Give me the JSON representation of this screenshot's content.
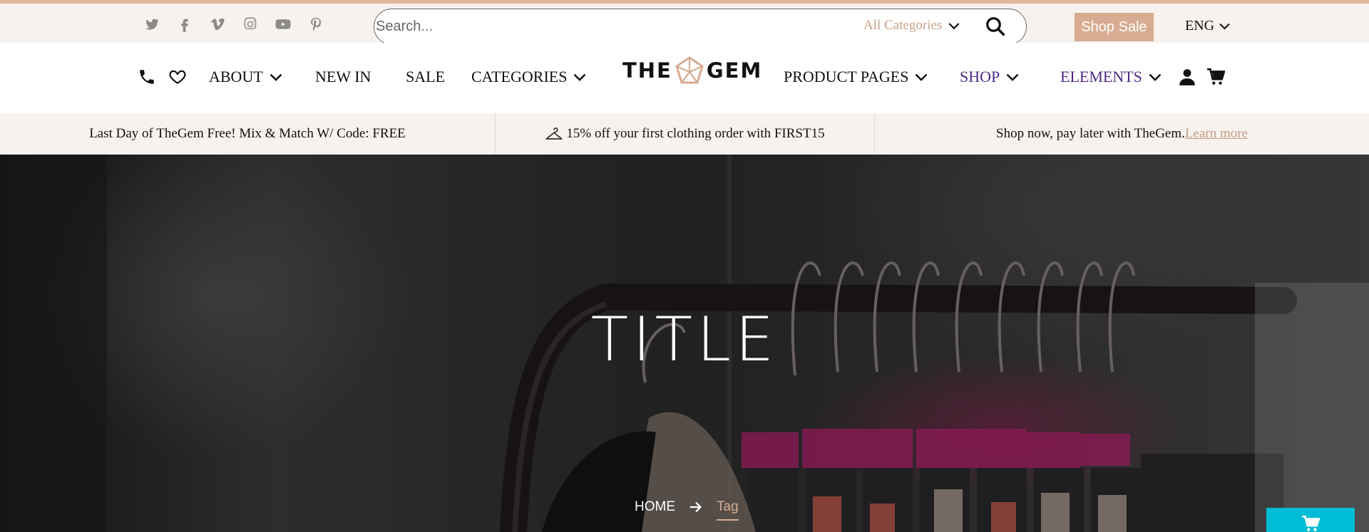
{
  "topbar": {
    "social_icons": [
      "twitter-icon",
      "facebook-icon",
      "vimeo-icon",
      "instagram-icon",
      "youtube-icon",
      "pinterest-icon"
    ],
    "search": {
      "placeholder": "Search...",
      "category_label": "All Categories"
    },
    "shop_sale_label": "Shop Sale",
    "language": "ENG"
  },
  "nav": {
    "about": "ABOUT",
    "new_in": "NEW IN",
    "sale": "SALE",
    "categories": "CATEGORIES",
    "logo_left": "THE",
    "logo_right": "GEM",
    "product_pages": "PRODUCT PAGES",
    "shop": "SHOP",
    "elements": "ELEMENTS"
  },
  "promo": {
    "left": "Last Day of TheGem Free! Mix & Match W/ Code: FREE",
    "center": "15% off your first clothing order with FIRST15",
    "right_text": "Shop now, pay later with TheGem.",
    "right_link": "Learn more"
  },
  "hero": {
    "title": "TITLE",
    "breadcrumb_home": "HOME",
    "breadcrumb_current": "Tag"
  },
  "colors": {
    "accent": "#d7ac92",
    "nav_highlight": "#4e2a84",
    "cart_fab": "#00bcd4",
    "topbar_bg": "#f7f2ee"
  }
}
